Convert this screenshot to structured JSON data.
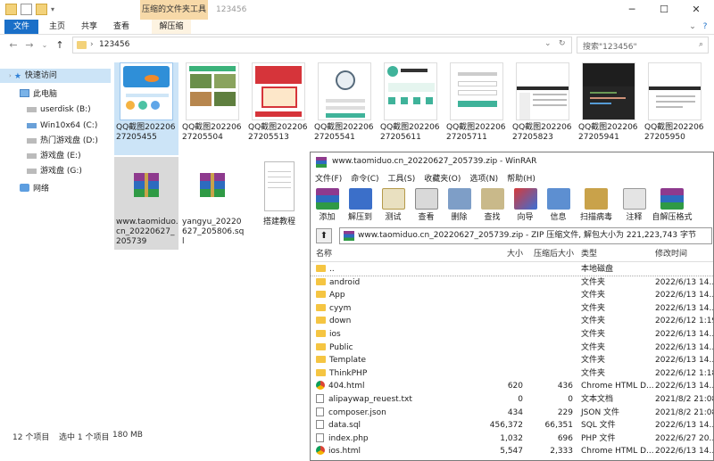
{
  "explorer": {
    "ctx_tab": "压缩的文件夹工具",
    "window_title": "123456",
    "tabs": [
      "文件",
      "主页",
      "共享",
      "查看",
      "解压缩"
    ],
    "path": "123456",
    "search_placeholder": "搜索\"123456\"",
    "sidebar": [
      {
        "label": "快速访问",
        "icon": "star-icon"
      },
      {
        "label": "此电脑",
        "icon": "computer-icon"
      },
      {
        "label": "userdisk (B:)",
        "icon": "drive-icon"
      },
      {
        "label": "Win10x64 (C:)",
        "icon": "drive-icon"
      },
      {
        "label": "热门游戏盘 (D:)",
        "icon": "drive-icon"
      },
      {
        "label": "游戏盘 (E:)",
        "icon": "drive-icon"
      },
      {
        "label": "游戏盘 (G:)",
        "icon": "drive-icon"
      },
      {
        "label": "网络",
        "icon": "network-icon"
      }
    ],
    "files": [
      "QQ截图20220627205455",
      "QQ截图20220627205504",
      "QQ截图20220627205513",
      "QQ截图20220627205541",
      "QQ截图20220627205611",
      "QQ截图20220627205711",
      "QQ截图20220627205823",
      "QQ截图20220627205941",
      "QQ截图20220627205950",
      "www.taomiduo.cn_20220627_205739",
      "yangyu_20220627_205806.sql",
      "搭建教程"
    ],
    "status": {
      "count": "12 个项目",
      "selected": "选中 1 个项目",
      "size": "180 MB"
    }
  },
  "winrar": {
    "title": "www.taomiduo.cn_20220627_205739.zip - WinRAR",
    "menu": [
      "文件(F)",
      "命令(C)",
      "工具(S)",
      "收藏夹(O)",
      "选项(N)",
      "帮助(H)"
    ],
    "toolbar": [
      "添加",
      "解压到",
      "测试",
      "查看",
      "删除",
      "查找",
      "向导",
      "信息",
      "扫描病毒",
      "注释",
      "自解压格式"
    ],
    "path": "www.taomiduo.cn_20220627_205739.zip - ZIP 压缩文件, 解包大小为 221,223,743 字节",
    "columns": [
      "名称",
      "大小",
      "压缩后大小",
      "类型",
      "修改时间"
    ],
    "rows": [
      {
        "name": "..",
        "size": "",
        "packed": "",
        "type": "本地磁盘",
        "mtime": "",
        "kind": "folder"
      },
      {
        "name": "android",
        "size": "",
        "packed": "",
        "type": "文件夹",
        "mtime": "2022/6/13 14...",
        "kind": "folder"
      },
      {
        "name": "App",
        "size": "",
        "packed": "",
        "type": "文件夹",
        "mtime": "2022/6/13 14...",
        "kind": "folder"
      },
      {
        "name": "cyym",
        "size": "",
        "packed": "",
        "type": "文件夹",
        "mtime": "2022/6/13 14...",
        "kind": "folder"
      },
      {
        "name": "down",
        "size": "",
        "packed": "",
        "type": "文件夹",
        "mtime": "2022/6/12 1:19",
        "kind": "folder"
      },
      {
        "name": "ios",
        "size": "",
        "packed": "",
        "type": "文件夹",
        "mtime": "2022/6/13 14...",
        "kind": "folder"
      },
      {
        "name": "Public",
        "size": "",
        "packed": "",
        "type": "文件夹",
        "mtime": "2022/6/13 14...",
        "kind": "folder"
      },
      {
        "name": "Template",
        "size": "",
        "packed": "",
        "type": "文件夹",
        "mtime": "2022/6/13 14...",
        "kind": "folder"
      },
      {
        "name": "ThinkPHP",
        "size": "",
        "packed": "",
        "type": "文件夹",
        "mtime": "2022/6/12 1:18",
        "kind": "folder"
      },
      {
        "name": "404.html",
        "size": "620",
        "packed": "436",
        "type": "Chrome HTML D...",
        "mtime": "2022/6/13 14...",
        "kind": "chrome"
      },
      {
        "name": "alipaywap_reuest.txt",
        "size": "0",
        "packed": "0",
        "type": "文本文档",
        "mtime": "2021/8/2 21:08",
        "kind": "doc"
      },
      {
        "name": "composer.json",
        "size": "434",
        "packed": "229",
        "type": "JSON 文件",
        "mtime": "2021/8/2 21:08",
        "kind": "doc"
      },
      {
        "name": "data.sql",
        "size": "456,372",
        "packed": "66,351",
        "type": "SQL 文件",
        "mtime": "2022/6/13 14...",
        "kind": "doc"
      },
      {
        "name": "index.php",
        "size": "1,032",
        "packed": "696",
        "type": "PHP 文件",
        "mtime": "2022/6/27 20...",
        "kind": "doc"
      },
      {
        "name": "ios.html",
        "size": "5,547",
        "packed": "2,333",
        "type": "Chrome HTML D...",
        "mtime": "2022/6/13 14...",
        "kind": "chrome"
      }
    ]
  }
}
